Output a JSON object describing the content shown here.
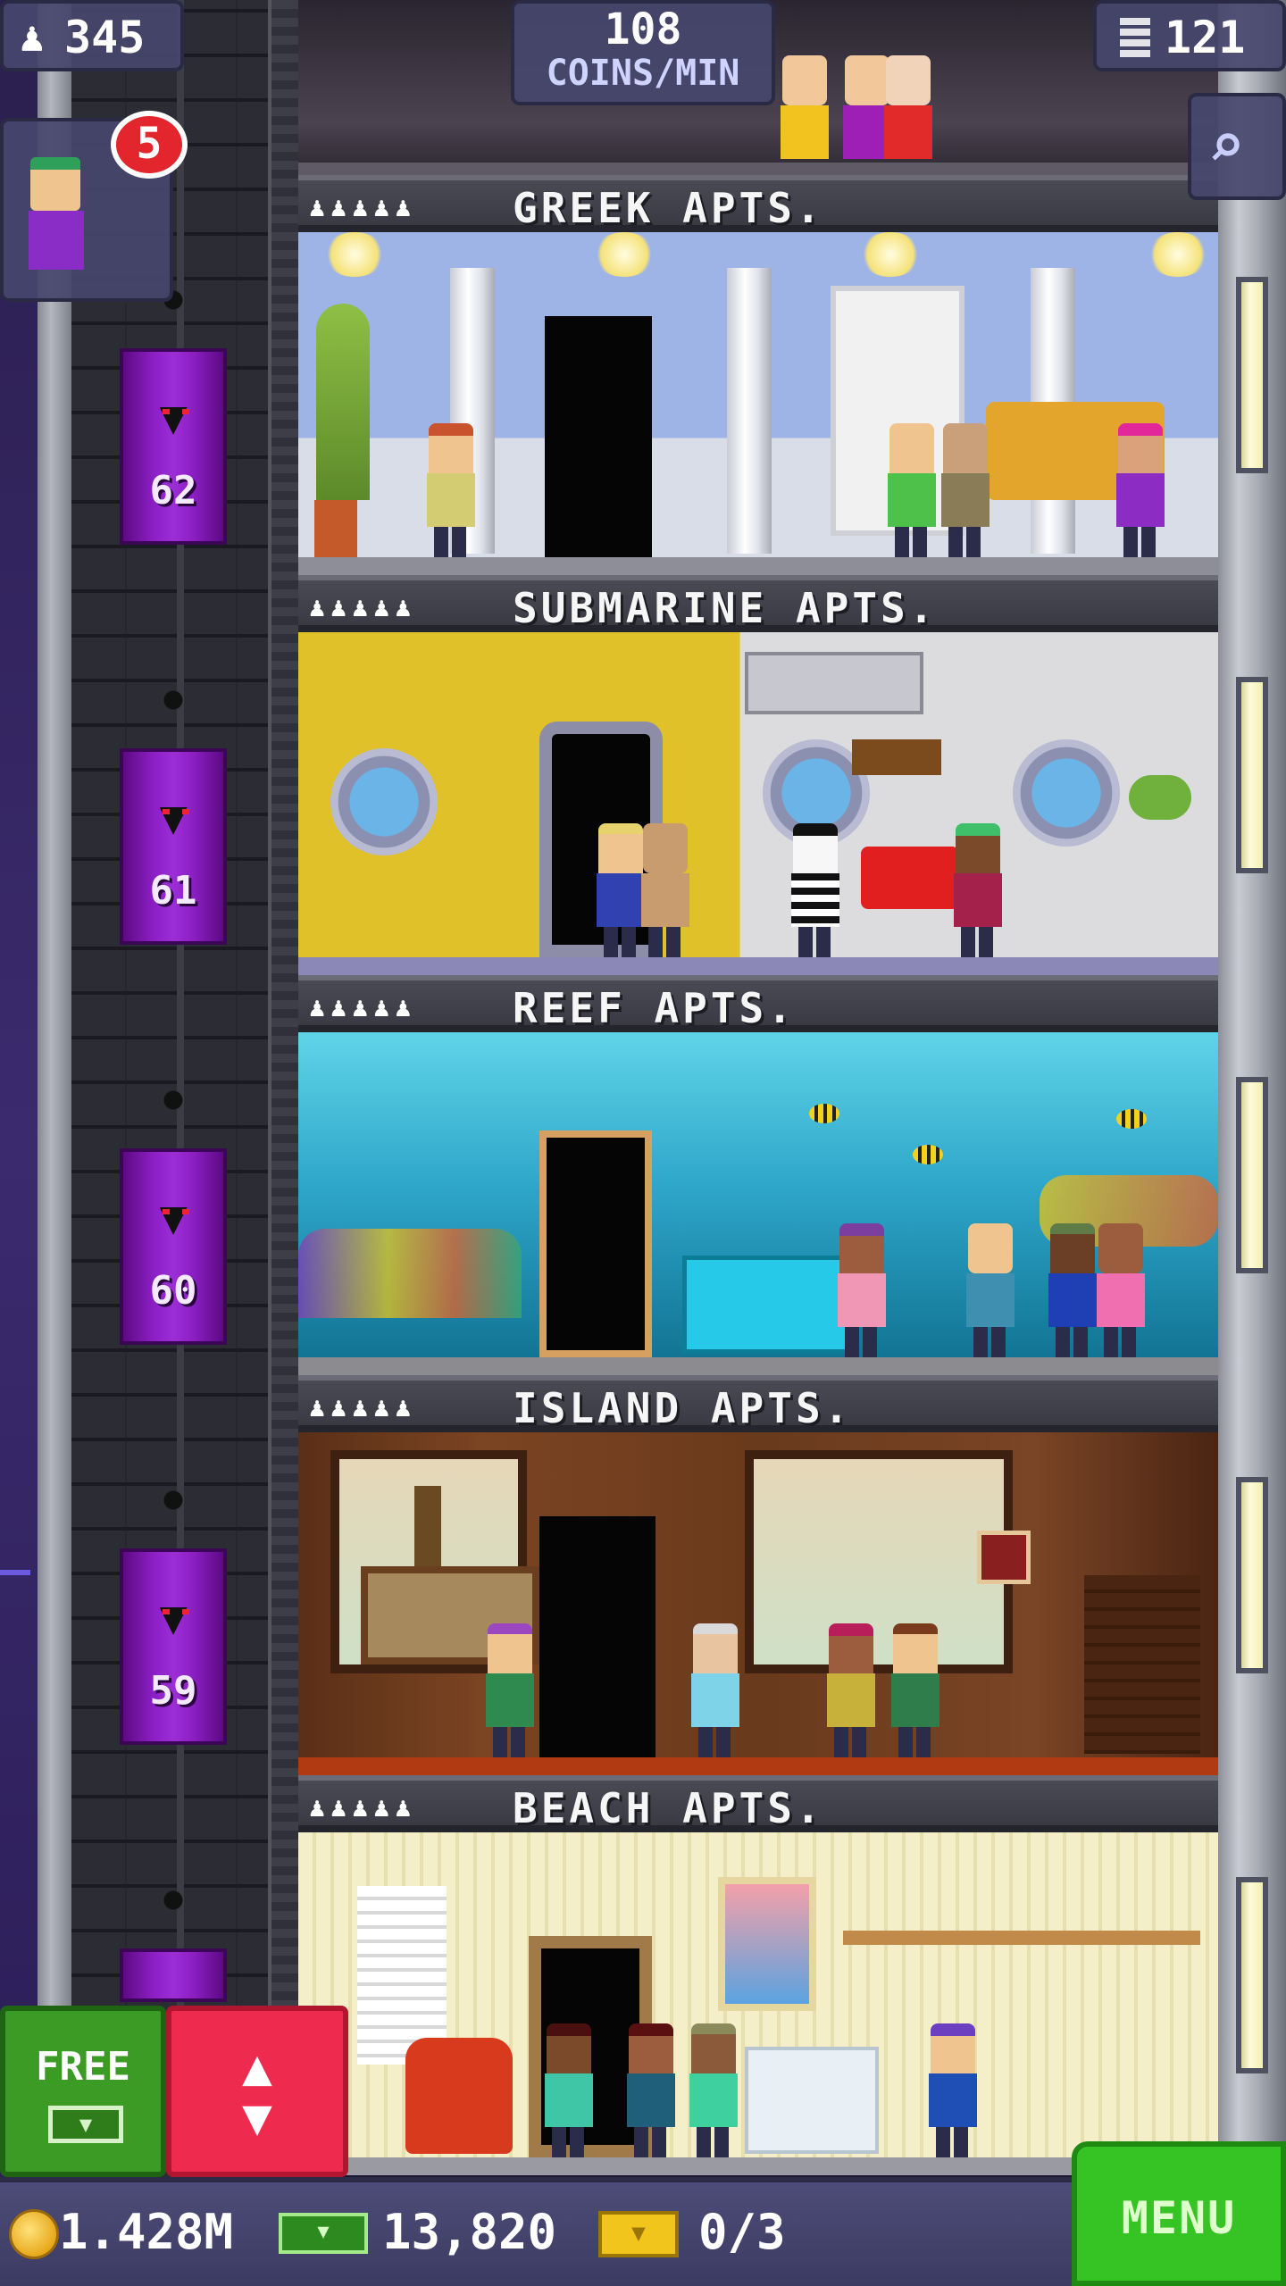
{
  "hud": {
    "population": "345",
    "coins_per_min_value": "108",
    "coins_per_min_unit": "COINS/MIN",
    "floor_count": "121",
    "visitor_badge": "5"
  },
  "elevator": {
    "floor_labels": [
      "62",
      "61",
      "60",
      "59"
    ]
  },
  "floors": [
    {
      "name": "GREEK APTS.",
      "stars": "♟♟♟♟♟"
    },
    {
      "name": "SUBMARINE APTS.",
      "stars": "♟♟♟♟♟"
    },
    {
      "name": "REEF APTS.",
      "stars": "♟♟♟♟♟"
    },
    {
      "name": "ISLAND APTS.",
      "stars": "♟♟♟♟♟"
    },
    {
      "name": "BEACH APTS.",
      "stars": "♟♟♟♟♟"
    }
  ],
  "controls": {
    "free_label": "FREE",
    "menu_label": "MENU"
  },
  "currency": {
    "coins": "1.428M",
    "bux": "13,820",
    "tickets": "0/3"
  },
  "icons": {
    "population": "person-icon",
    "floors": "building-icon",
    "search": "magnifier-icon",
    "elevator": "up-down-arrows-icon",
    "bux": "bux-bill-icon",
    "coin": "coin-icon",
    "ticket": "golden-ticket-icon"
  },
  "colors": {
    "elevator": "#8b1fc4",
    "free_button": "#3b9b25",
    "elevator_button": "#ee2a4f",
    "menu_button": "#35c423",
    "badge": "#e3262d"
  }
}
